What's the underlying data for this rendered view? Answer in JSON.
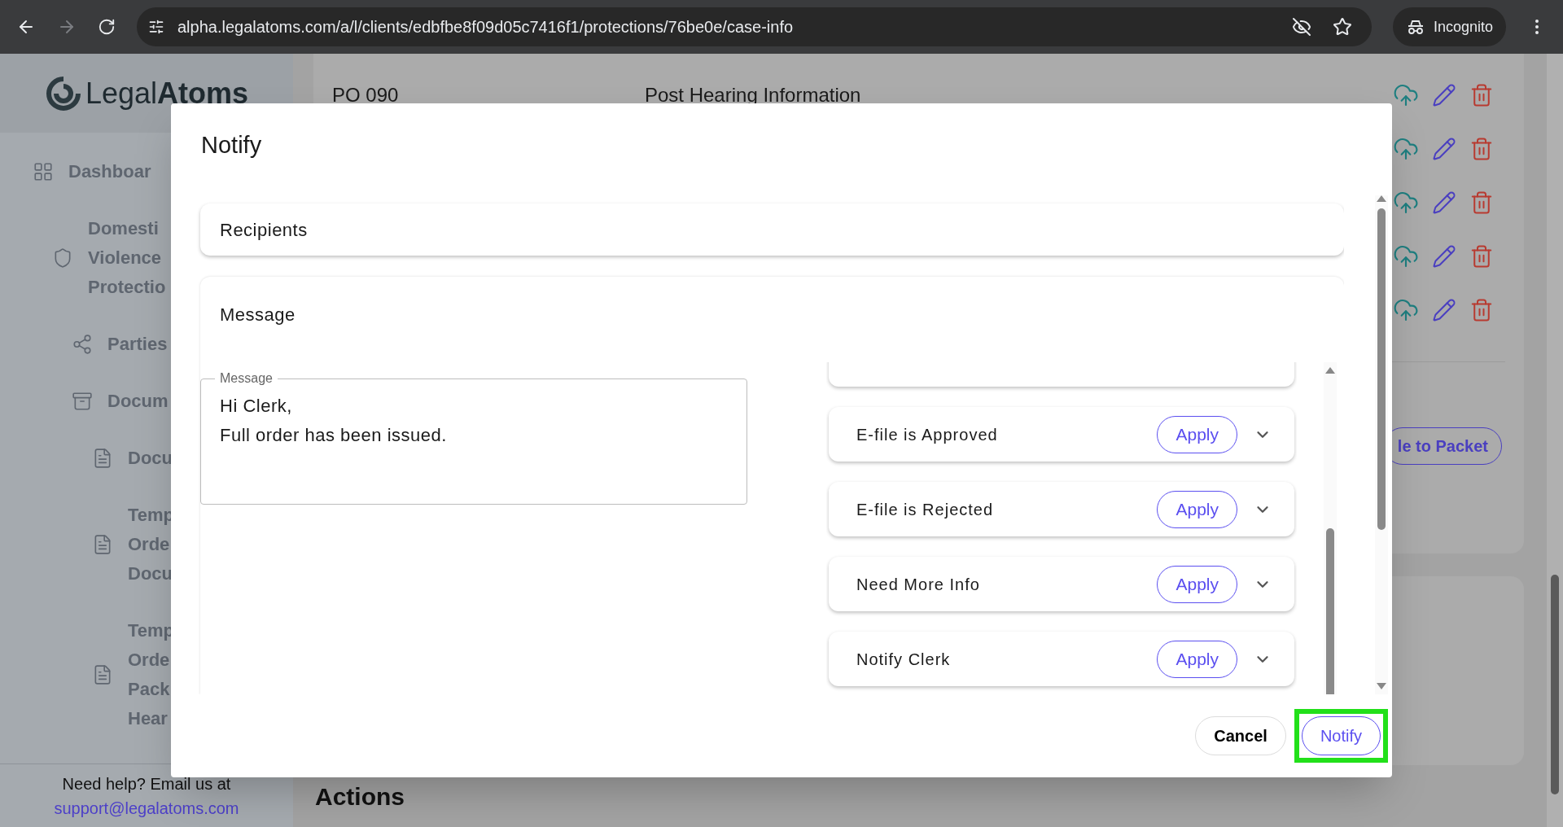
{
  "browser": {
    "url": "alpha.legalatoms.com/a/l/clients/edbfbe8f09d05c7416f1/protections/76be0e/case-info",
    "profile": "Incognito"
  },
  "sidebar": {
    "logo": {
      "regular": "Legal",
      "bold": "Atoms"
    },
    "items": [
      {
        "kind": "dashboard",
        "lines": [
          "Dashboar"
        ]
      },
      {
        "kind": "case",
        "lines": [
          "Domesti",
          "Violence",
          "Protectio"
        ],
        "children": [
          {
            "kind": "parties",
            "lines": [
              "Parties"
            ]
          },
          {
            "kind": "folder",
            "lines": [
              "Docum"
            ],
            "children": [
              {
                "kind": "document",
                "lines": [
                  "Docu"
                ]
              },
              {
                "kind": "document",
                "lines": [
                  "Temp",
                  "Orde",
                  "Docu"
                ]
              },
              {
                "kind": "document",
                "lines": [
                  "Temp",
                  "Orde",
                  "Pack",
                  "Hear"
                ]
              }
            ]
          }
        ]
      }
    ],
    "help_text": "Need help? Email us at",
    "help_email": "support@legalatoms.com"
  },
  "main": {
    "document_row": {
      "code": "PO 090",
      "title": "Post Hearing Information"
    },
    "packet_button": "le to Packet",
    "actions_heading": "Actions"
  },
  "dialog": {
    "title": "Notify",
    "sections": [
      {
        "title": "Recipients"
      },
      {
        "title": "Message"
      }
    ],
    "message_field": {
      "label": "Message",
      "value": "Hi Clerk,\nFull order has been issued."
    },
    "templates": [
      {
        "name": "E-file is Approved",
        "action": "Apply"
      },
      {
        "name": "E-file is Rejected",
        "action": "Apply"
      },
      {
        "name": "Need More Info",
        "action": "Apply"
      },
      {
        "name": "Notify Clerk",
        "action": "Apply"
      }
    ],
    "buttons": [
      {
        "label": "Cancel",
        "kind": "secondary",
        "highlighted": false
      },
      {
        "label": "Notify",
        "kind": "primary",
        "highlighted": true
      }
    ]
  }
}
